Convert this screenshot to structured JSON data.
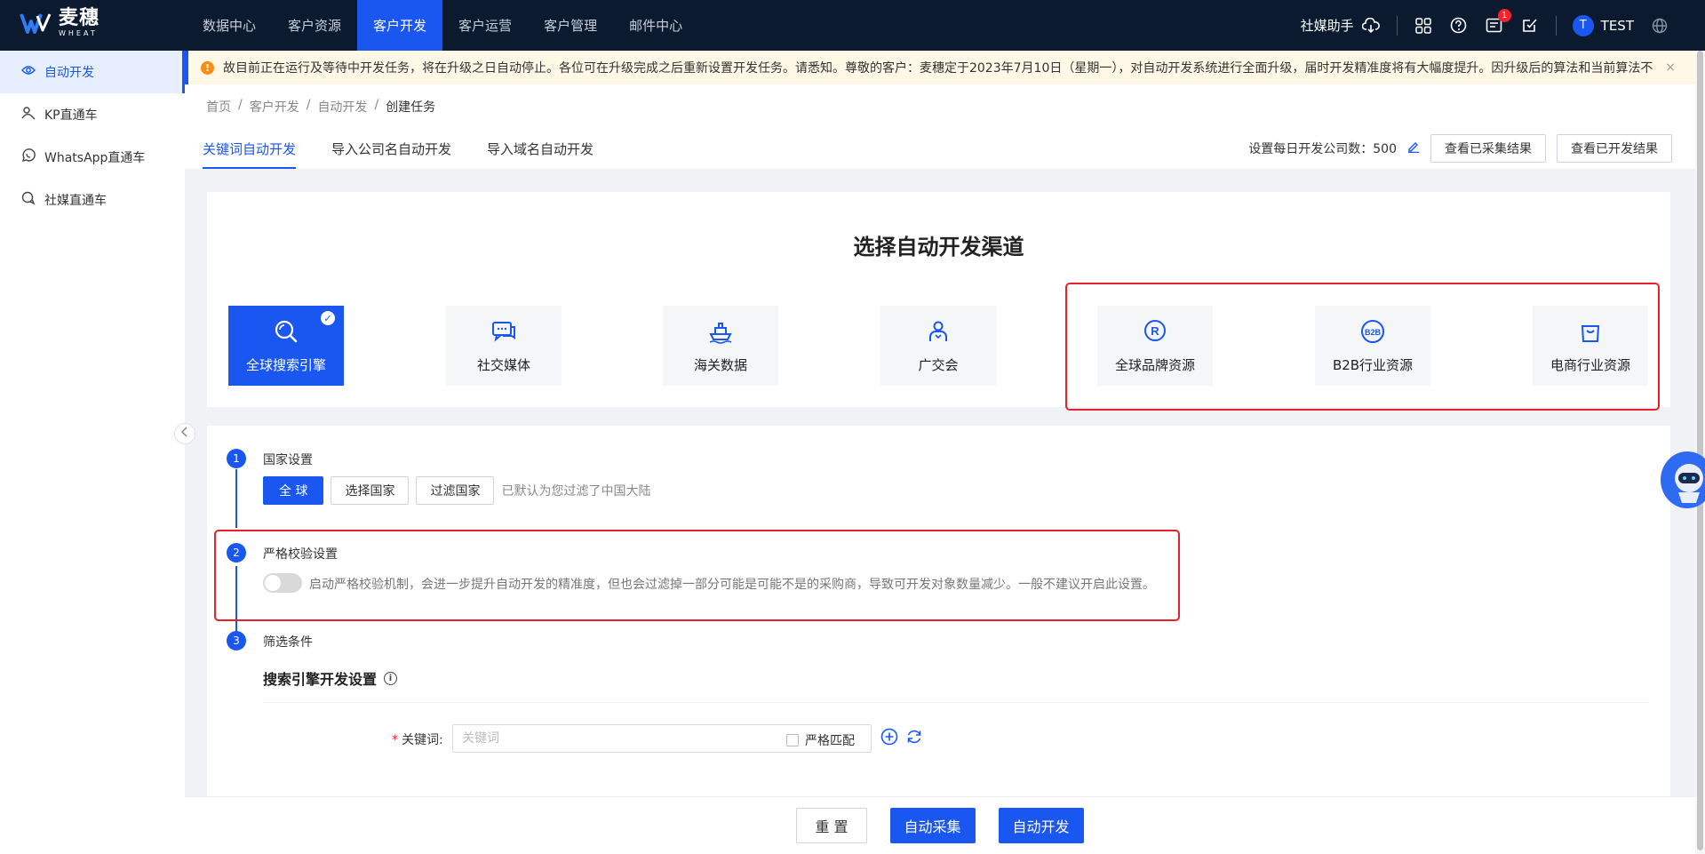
{
  "app": {
    "logo_cn": "麦穗",
    "logo_en": "WHEAT"
  },
  "nav": {
    "items": [
      {
        "label": "数据中心"
      },
      {
        "label": "客户资源"
      },
      {
        "label": "客户开发",
        "active": true
      },
      {
        "label": "客户运营"
      },
      {
        "label": "客户管理"
      },
      {
        "label": "邮件中心"
      }
    ],
    "social_assistant": "社媒助手",
    "notification_count": "1",
    "avatar_letter": "T",
    "username": "TEST"
  },
  "sidebar": {
    "items": [
      {
        "label": "自动开发",
        "icon": "radar-icon",
        "active": true
      },
      {
        "label": "KP直通车",
        "icon": "person-search-icon"
      },
      {
        "label": "WhatsApp直通车",
        "icon": "whatsapp-icon"
      },
      {
        "label": "社媒直通车",
        "icon": "chat-bubble-icon"
      }
    ]
  },
  "notice": {
    "text": "故目前正在运行及等待中开发任务，将在升级之日自动停止。各位可在升级完成之后重新设置开发任务。请悉知。尊敬的客户：麦穗定于2023年7月10日（星期一），对自动开发系统进行全面升级，届时开发精准度将有大幅度提升。因升级后的算法和当前算法不一",
    "close": "×"
  },
  "breadcrumb": {
    "items": [
      "首页",
      "客户开发",
      "自动开发"
    ],
    "current": "创建任务",
    "sep": "/"
  },
  "tabs": [
    {
      "label": "关键词自动开发",
      "active": true
    },
    {
      "label": "导入公司名自动开发"
    },
    {
      "label": "导入域名自动开发"
    }
  ],
  "header": {
    "daily_label": "设置每日开发公司数：",
    "daily_value": "500",
    "view_collected": "查看已采集结果",
    "view_developed": "查看已开发结果"
  },
  "channels": {
    "title": "选择自动开发渠道",
    "items": [
      {
        "label": "全球搜索引擎",
        "icon": "search-engine-icon",
        "active": true
      },
      {
        "label": "社交媒体",
        "icon": "social-chat-icon"
      },
      {
        "label": "海关数据",
        "icon": "ship-icon"
      },
      {
        "label": "广交会",
        "icon": "person-icon"
      },
      {
        "label": "全球品牌资源",
        "icon": "brand-badge-icon"
      },
      {
        "label": "B2B行业资源",
        "icon": "b2b-icon"
      },
      {
        "label": "电商行业资源",
        "icon": "shopping-bag-icon"
      }
    ]
  },
  "steps": {
    "s1": {
      "num": "1",
      "label": "国家设置",
      "btn_global": "全 球",
      "btn_select": "选择国家",
      "btn_filter": "过滤国家",
      "hint": "已默认为您过滤了中国大陆"
    },
    "s2": {
      "num": "2",
      "label": "严格校验设置",
      "toggle_on": false,
      "hint": "启动严格校验机制，会进一步提升自动开发的精准度，但也会过滤掉一部分可能是可能不是的采购商，导致可开发对象数量减少。一般不建议开启此设置。"
    },
    "s3": {
      "num": "3",
      "label": "筛选条件"
    }
  },
  "search_settings": {
    "title": "搜索引擎开发设置",
    "keyword_label": "关键词:",
    "keyword_placeholder": "关键词",
    "keyword_value": "",
    "strict_match": "严格匹配"
  },
  "footer": {
    "reset": "重 置",
    "collect": "自动采集",
    "develop": "自动开发"
  },
  "colors": {
    "primary": "#1a56f0",
    "topbar": "#0b1a2e",
    "highlight": "#e8202a",
    "warning": "#fa8c16"
  }
}
